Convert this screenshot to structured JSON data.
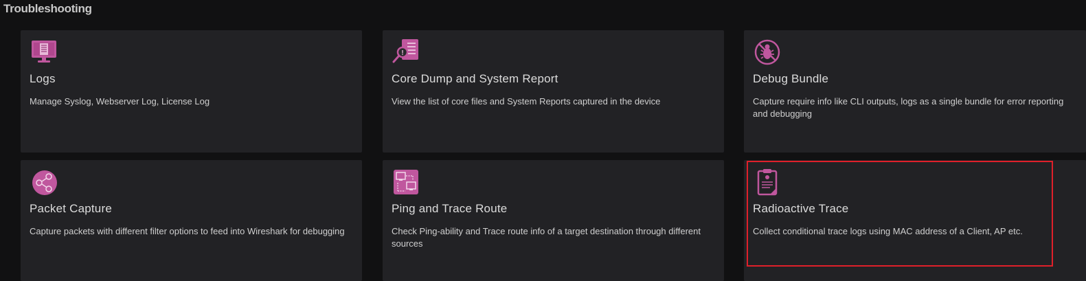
{
  "page": {
    "title": "Troubleshooting"
  },
  "colors": {
    "accent": "#c0579e",
    "highlight_border": "#e0202a"
  },
  "cards": [
    {
      "title": "Logs",
      "description": "Manage Syslog, Webserver Log, License Log",
      "icon": "monitor-log-icon"
    },
    {
      "title": "Core Dump and System Report",
      "description": "View the list of core files and System Reports captured in the device",
      "icon": "report-search-icon"
    },
    {
      "title": "Debug Bundle",
      "description": "Capture require info like CLI outputs, logs as a single bundle for error reporting and debugging",
      "icon": "no-bug-icon"
    },
    {
      "title": "Packet Capture",
      "description": "Capture packets with different filter options to feed into Wireshark for debugging",
      "icon": "share-nodes-icon"
    },
    {
      "title": "Ping and Trace Route",
      "description": "Check Ping-ability and Trace route info of a target destination through different sources",
      "icon": "network-trace-icon"
    },
    {
      "title": "Radioactive Trace",
      "description": "Collect conditional trace logs using MAC address of a Client, AP etc.",
      "icon": "clipboard-radioactive-icon",
      "highlighted": true
    }
  ]
}
